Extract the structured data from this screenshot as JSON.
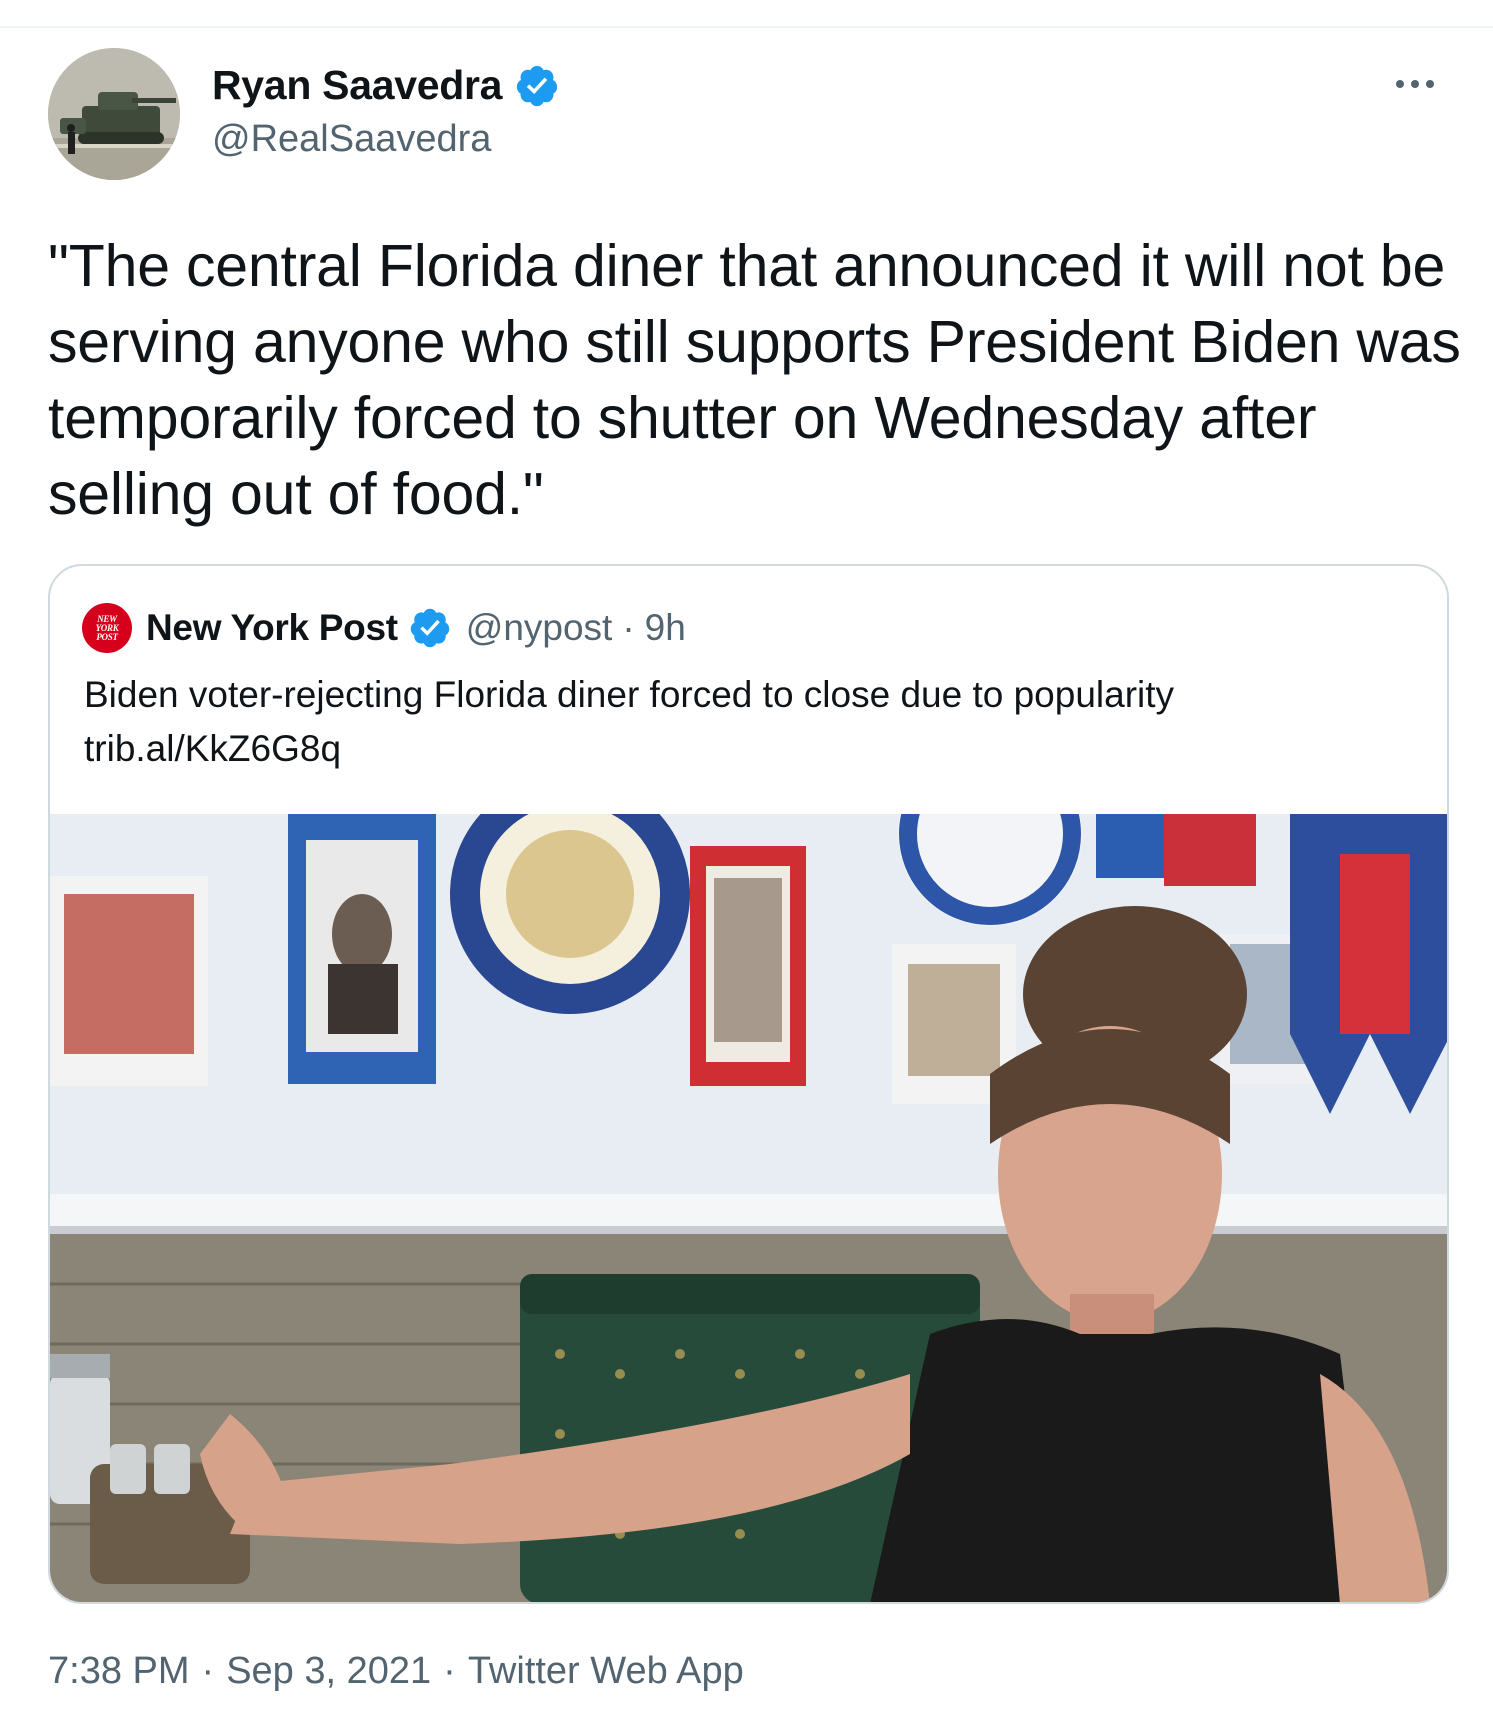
{
  "author": {
    "name": "Ryan Saavedra",
    "handle": "@RealSaavedra",
    "verified": true,
    "avatar_icon": "avatar-image"
  },
  "tweet": {
    "text": "\"The central Florida diner that announced it will not be serving anyone who still supports President Biden was temporarily forced to shutter on Wednesday after selling out of food.\""
  },
  "quoted": {
    "logo_lines": [
      "NEW",
      "YORK",
      "POST"
    ],
    "name": "New York Post",
    "verified": true,
    "handle": "@nypost",
    "separator": "·",
    "time": "9h",
    "text": "Biden voter-rejecting Florida diner forced to close due to popularity",
    "link": "trib.al/KkZ6G8q",
    "image_icon": "news-photo"
  },
  "meta": {
    "time": "7:38 PM",
    "separator": "·",
    "date": "Sep 3, 2021",
    "source": "Twitter Web App"
  },
  "colors": {
    "text": "#0f1419",
    "secondary": "#536471",
    "verified": "#1d9bf0",
    "border": "#cfd9de",
    "nypost_red": "#d6001c"
  }
}
